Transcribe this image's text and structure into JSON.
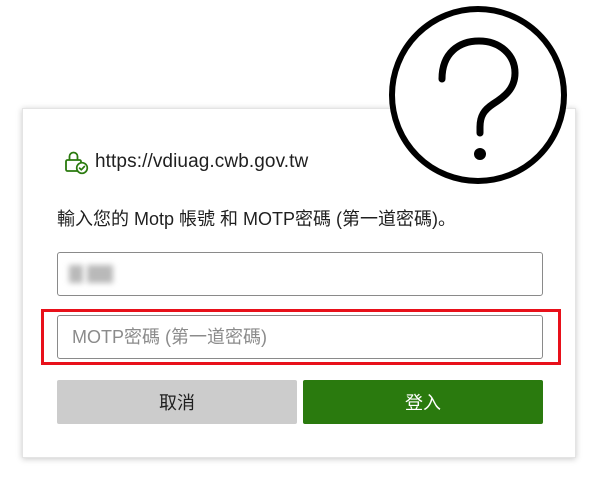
{
  "dialog": {
    "site": {
      "icon": "lock-check-icon",
      "url": "https://vdiuag.cwb.gov.tw",
      "icon_color": "#2a7a0e"
    },
    "prompt": "輸入您的 Motp 帳號 和 MOTP密碼 (第一道密碼)。",
    "username": {
      "value_blurred": true
    },
    "password": {
      "placeholder": "MOTP密碼 (第一道密碼)",
      "highlight_color": "#e8101a"
    },
    "buttons": {
      "cancel_label": "取消",
      "login_label": "登入",
      "login_color": "#2a7a0e"
    }
  },
  "overlay": {
    "icon": "question-mark-icon"
  }
}
